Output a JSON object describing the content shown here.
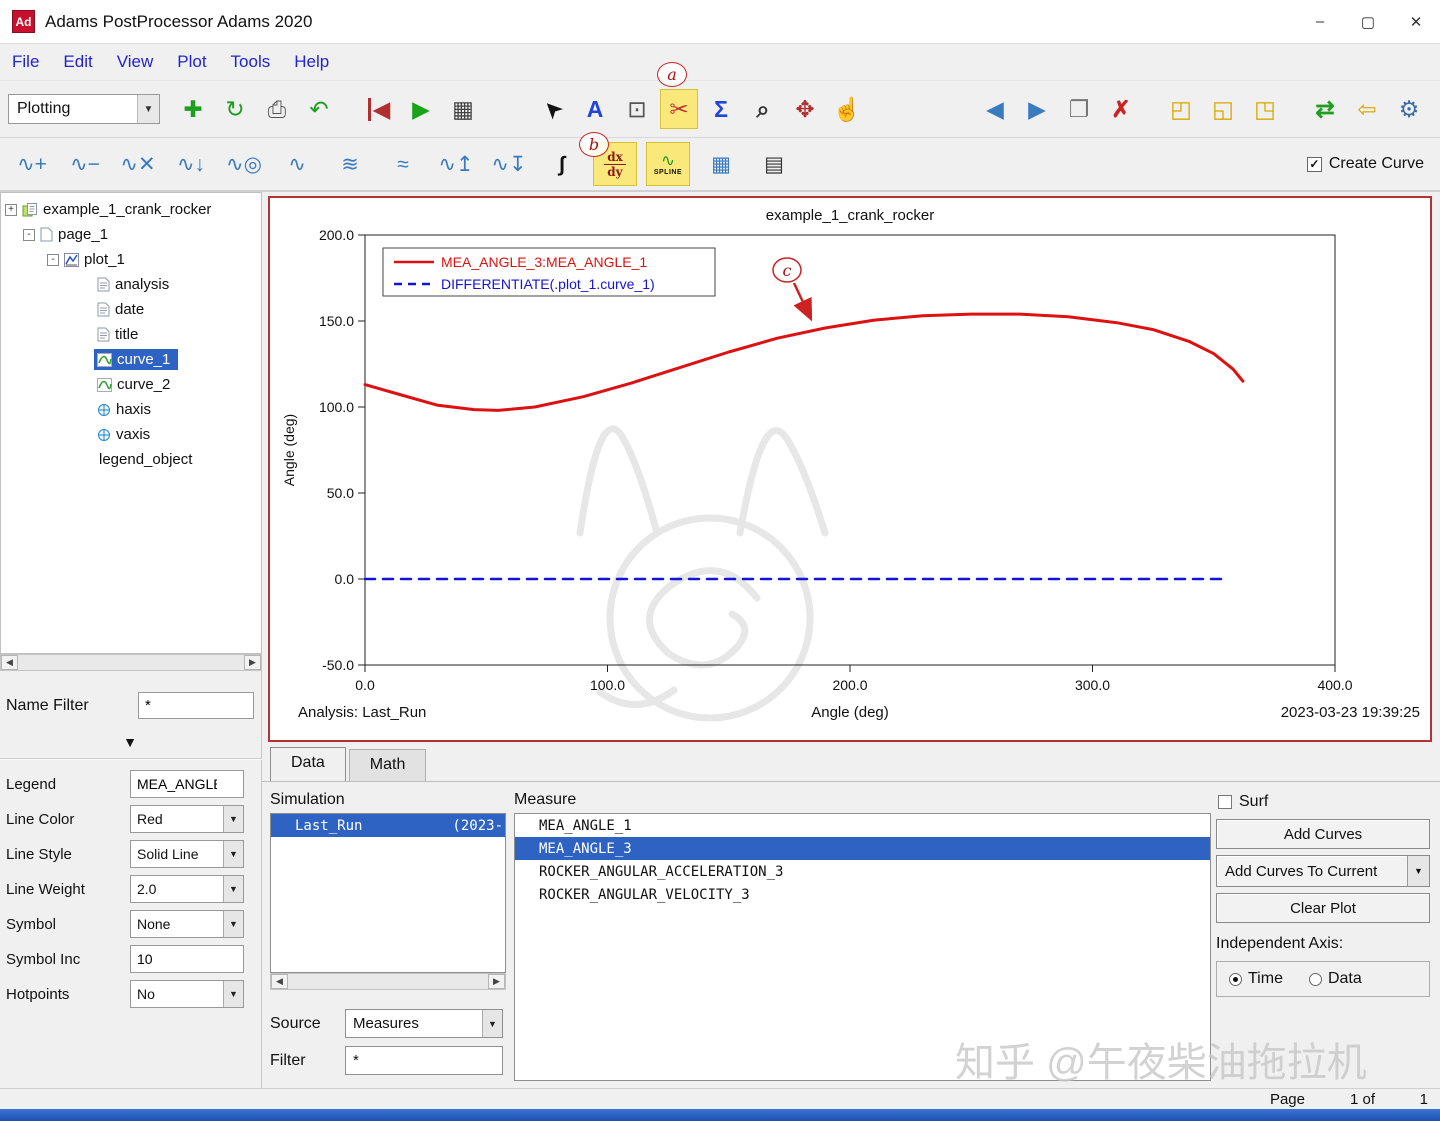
{
  "window": {
    "logo": "Ad",
    "title": "Adams PostProcessor Adams 2020",
    "minimize": "–",
    "maximize": "▢",
    "close": "✕"
  },
  "menu": {
    "items": [
      "File",
      "Edit",
      "View",
      "Plot",
      "Tools",
      "Help"
    ]
  },
  "glyphs": {
    "dd": "▼",
    "big_down": "▼",
    "check": "✓",
    "left": "◀",
    "right": "▶",
    "plus": "+",
    "minus": "-"
  },
  "toolbar1": {
    "mode": "Plotting",
    "file_icons": [
      {
        "name": "new-page-icon",
        "glyph": "✚",
        "color": "#1e9e1e"
      },
      {
        "name": "refresh-icon",
        "glyph": "↻",
        "color": "#1e9e1e"
      },
      {
        "name": "print-icon",
        "glyph": "⎙",
        "color": "#555555"
      },
      {
        "name": "undo-icon",
        "glyph": "↶",
        "color": "#1e9e1e"
      }
    ],
    "play_icons": [
      {
        "name": "step-start-icon",
        "glyph": "◀",
        "color": "#b03030",
        "cls": "bar-l"
      },
      {
        "name": "play-icon",
        "glyph": "▶",
        "color": "#19a319"
      },
      {
        "name": "animation-icon",
        "glyph": "▦",
        "color": "#444444"
      }
    ],
    "tool_icons": [
      {
        "name": "select-cursor-icon",
        "glyph": "➤",
        "color": "#111111",
        "cls": "rot-up"
      },
      {
        "name": "text-tool-icon",
        "glyph": "A",
        "color": "#2244dd",
        "cls": "bold"
      },
      {
        "name": "plot-layout-icon",
        "glyph": "⊡",
        "color": "#555555"
      },
      {
        "name": "curve-edit-icon",
        "glyph": "✂",
        "color": "#c03030",
        "boxcls": "hl"
      },
      {
        "name": "sum-icon",
        "glyph": "Σ",
        "color": "#2244dd",
        "cls": "bold"
      },
      {
        "name": "zoom-region-icon",
        "glyph": "⌕",
        "color": "#333333",
        "cls": "bold"
      },
      {
        "name": "fit-view-icon",
        "glyph": "✥",
        "color": "#b03030"
      },
      {
        "name": "pan-hand-icon",
        "glyph": "☝",
        "color": "#c8a15a"
      }
    ],
    "page_icons": [
      {
        "name": "prev-view-icon",
        "glyph": "◀",
        "color": "#3a7abf"
      },
      {
        "name": "next-view-icon",
        "glyph": "▶",
        "color": "#3a7abf"
      },
      {
        "name": "new-window-icon",
        "glyph": "❐",
        "color": "#777777"
      },
      {
        "name": "delete-page-icon",
        "glyph": "✗",
        "color": "#cc2222",
        "cls": "bold"
      }
    ],
    "layout_icons": [
      {
        "name": "layout-full-icon",
        "glyph": "◰",
        "color": "#d8a800"
      },
      {
        "name": "layout-split-icon",
        "glyph": "◱",
        "color": "#d8a800"
      },
      {
        "name": "layout-quad-icon",
        "glyph": "◳",
        "color": "#d8a800"
      }
    ],
    "right_icons": [
      {
        "name": "swap-view-icon",
        "glyph": "⇄",
        "color": "#1e9e1e",
        "cls": "bold"
      },
      {
        "name": "return-icon",
        "glyph": "⇦",
        "color": "#d8a800"
      },
      {
        "name": "settings-gear-icon",
        "glyph": "⚙",
        "color": "#3a6ea5"
      }
    ]
  },
  "toolbar2": {
    "icons_a": [
      {
        "name": "curve-zoom-in-icon",
        "glyph": "∿+",
        "color": "#3a7abf"
      },
      {
        "name": "curve-zoom-out-icon",
        "glyph": "∿−",
        "color": "#3a7abf"
      },
      {
        "name": "curve-delete-icon",
        "glyph": "∿✕",
        "color": "#3a7abf"
      },
      {
        "name": "curve-offset-icon",
        "glyph": "∿↓",
        "color": "#3a7abf"
      },
      {
        "name": "curve-scale-icon",
        "glyph": "∿◎",
        "color": "#3a7abf"
      },
      {
        "name": "curve-sine-icon",
        "glyph": "∿",
        "color": "#3a7abf"
      },
      {
        "name": "curve-multi-wave-icon",
        "glyph": "≋",
        "color": "#3a7abf"
      },
      {
        "name": "curve-smooth-icon",
        "glyph": "≈",
        "color": "#3a7abf"
      },
      {
        "name": "curve-shift-up-icon",
        "glyph": "∿↥",
        "color": "#3a7abf"
      },
      {
        "name": "curve-shift-down-icon",
        "glyph": "∿↧",
        "color": "#3a7abf"
      },
      {
        "name": "integrate-icon",
        "glyph": "∫",
        "color": "#111111",
        "cls": "bold"
      }
    ],
    "dxdy": {
      "top": "dx",
      "bottom": "dy"
    },
    "spline": {
      "glyph": "∿",
      "label": "SPLINE"
    },
    "icons_b": [
      {
        "name": "fft-plot-icon",
        "glyph": "▦",
        "color": "#3a7abf"
      },
      {
        "name": "bode-plot-icon",
        "glyph": "▤",
        "color": "#333333"
      }
    ],
    "create_curve_label": "Create Curve"
  },
  "tree": {
    "root": "example_1_crank_rocker",
    "page": "page_1",
    "plot": "plot_1",
    "children": [
      "analysis",
      "date",
      "title"
    ],
    "curve1": "curve_1",
    "curve2": "curve_2",
    "haxis": "haxis",
    "vaxis": "vaxis",
    "legend": "legend_object"
  },
  "name_filter": {
    "label": "Name Filter",
    "value": "*"
  },
  "properties": {
    "legend_label": "Legend",
    "legend_value": "MEA_ANGLE",
    "line_color_label": "Line Color",
    "line_color_value": "Red",
    "line_style_label": "Line Style",
    "line_style_value": "Solid Line",
    "line_weight_label": "Line Weight",
    "line_weight_value": "2.0",
    "symbol_label": "Symbol",
    "symbol_value": "None",
    "symbol_inc_label": "Symbol Inc",
    "symbol_inc_value": "10",
    "hotpoints_label": "Hotpoints",
    "hotpoints_value": "No"
  },
  "chart_data": {
    "type": "line",
    "title": "example_1_crank_rocker",
    "xlabel": "Angle (deg)",
    "ylabel": "Angle (deg)",
    "xlim": [
      0,
      400
    ],
    "ylim": [
      -50,
      200
    ],
    "x_ticks": [
      0,
      100,
      200,
      300,
      400
    ],
    "y_ticks": [
      -50,
      0,
      50,
      100,
      150,
      200
    ],
    "footer_left": "Analysis:  Last_Run",
    "footer_right": "2023-03-23 19:39:25",
    "legend_position": "top-left",
    "grid": false,
    "legend": [
      {
        "label": "MEA_ANGLE_3:MEA_ANGLE_1",
        "color": "#dd1111",
        "dash": ""
      },
      {
        "label": "DIFFERENTIATE(.plot_1.curve_1)",
        "color": "#1414d6",
        "dash": "8 6"
      }
    ],
    "series": [
      {
        "name": "MEA_ANGLE_3:MEA_ANGLE_1",
        "color": "#dd1111",
        "width": 3,
        "dash": "",
        "points": [
          [
            0,
            113
          ],
          [
            15,
            107
          ],
          [
            30,
            101
          ],
          [
            45,
            98.5
          ],
          [
            55,
            98
          ],
          [
            70,
            100
          ],
          [
            90,
            106
          ],
          [
            110,
            114
          ],
          [
            130,
            123
          ],
          [
            150,
            132
          ],
          [
            170,
            140
          ],
          [
            190,
            146
          ],
          [
            210,
            150.5
          ],
          [
            230,
            153
          ],
          [
            250,
            154
          ],
          [
            270,
            154
          ],
          [
            290,
            152.5
          ],
          [
            310,
            149
          ],
          [
            325,
            145
          ],
          [
            340,
            138
          ],
          [
            350,
            131
          ],
          [
            358,
            122
          ],
          [
            362,
            115
          ]
        ]
      },
      {
        "name": "DIFFERENTIATE(.plot_1.curve_1)",
        "color": "#1414d6",
        "width": 2.5,
        "dash": "10 8",
        "points": [
          [
            0,
            0
          ],
          [
            356,
            0
          ]
        ]
      }
    ]
  },
  "bottom": {
    "tabs": [
      "Data",
      "Math"
    ],
    "simulation_label": "Simulation",
    "sim_row": {
      "name": "Last_Run",
      "date": "(2023-"
    },
    "source_label": "Source",
    "source_value": "Measures",
    "filter_label": "Filter",
    "filter_value": "*",
    "measure_label": "Measure",
    "measures": [
      {
        "label": "MEA_ANGLE_1",
        "state": ""
      },
      {
        "label": "MEA_ANGLE_3",
        "state": "sel"
      },
      {
        "label": "ROCKER_ANGULAR_ACCELERATION_3",
        "state": ""
      },
      {
        "label": "ROCKER_ANGULAR_VELOCITY_3",
        "state": ""
      }
    ],
    "surf_label": "Surf",
    "add_curves": "Add Curves",
    "add_curves_to_current": "Add Curves To Current",
    "clear_plot": "Clear Plot",
    "independent_axis_label": "Independent Axis:",
    "radio_time": "Time",
    "radio_data": "Data"
  },
  "status": {
    "page_label": "Page",
    "page_mid": "1 of",
    "page_total": "1"
  },
  "annotations": {
    "a": "a",
    "b": "b",
    "c": "c"
  },
  "watermark_text": "知乎 @午夜柴油拖拉机"
}
